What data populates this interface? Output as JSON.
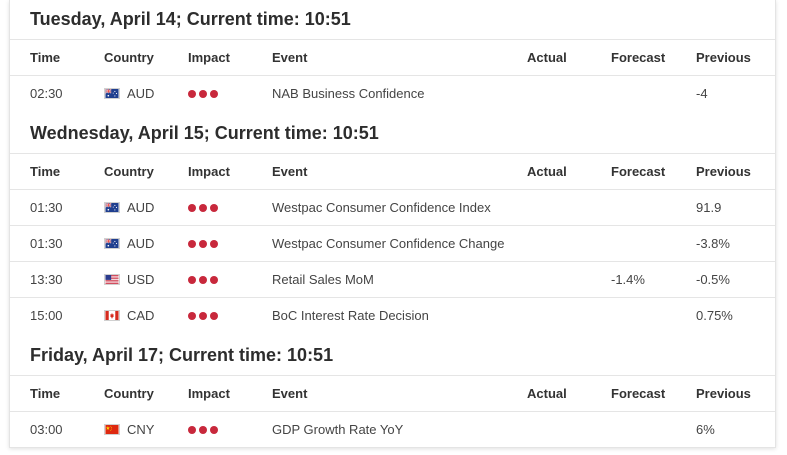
{
  "colors": {
    "impact_high": "#c8283c",
    "border": "#e5e5e5",
    "title": "#2d2d2d"
  },
  "headers": {
    "time": "Time",
    "country": "Country",
    "impact": "Impact",
    "event": "Event",
    "actual": "Actual",
    "forecast": "Forecast",
    "previous": "Previous"
  },
  "days": [
    {
      "title": "Tuesday, April 14; Current time: 10:51",
      "events": [
        {
          "time": "02:30",
          "flag": "au-flag-icon",
          "country": "AUD",
          "impact": "high",
          "event": "NAB Business Confidence",
          "actual": "",
          "forecast": "",
          "previous": "-4"
        }
      ]
    },
    {
      "title": "Wednesday, April 15; Current time: 10:51",
      "events": [
        {
          "time": "01:30",
          "flag": "au-flag-icon",
          "country": "AUD",
          "impact": "high",
          "event": "Westpac Consumer Confidence Index",
          "actual": "",
          "forecast": "",
          "previous": "91.9"
        },
        {
          "time": "01:30",
          "flag": "au-flag-icon",
          "country": "AUD",
          "impact": "high",
          "event": "Westpac Consumer Confidence Change",
          "actual": "",
          "forecast": "",
          "previous": "-3.8%"
        },
        {
          "time": "13:30",
          "flag": "us-flag-icon",
          "country": "USD",
          "impact": "high",
          "event": "Retail Sales MoM",
          "actual": "",
          "forecast": "-1.4%",
          "previous": "-0.5%"
        },
        {
          "time": "15:00",
          "flag": "ca-flag-icon",
          "country": "CAD",
          "impact": "high",
          "event": "BoC Interest Rate Decision",
          "actual": "",
          "forecast": "",
          "previous": "0.75%"
        }
      ]
    },
    {
      "title": "Friday, April 17; Current time: 10:51",
      "events": [
        {
          "time": "03:00",
          "flag": "cn-flag-icon",
          "country": "CNY",
          "impact": "high",
          "event": "GDP Growth Rate YoY",
          "actual": "",
          "forecast": "",
          "previous": "6%"
        }
      ]
    }
  ]
}
